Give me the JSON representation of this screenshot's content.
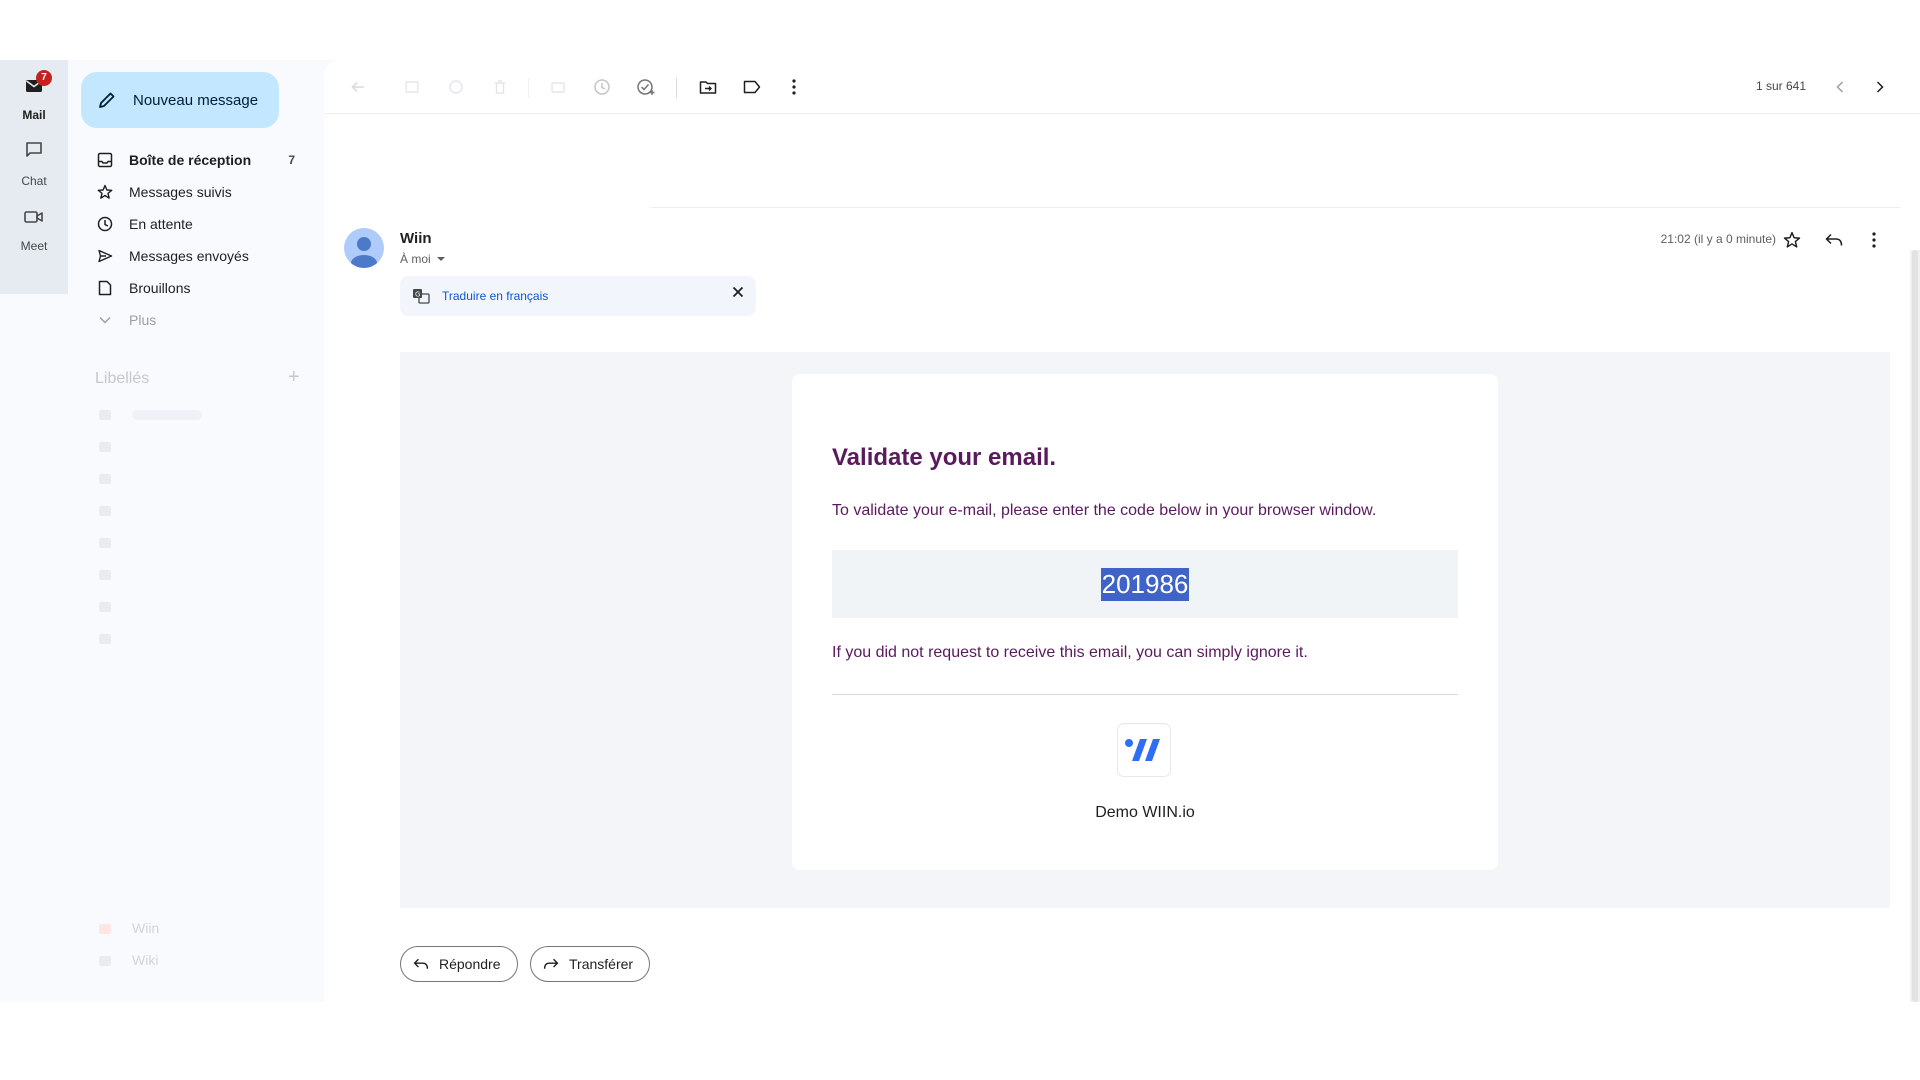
{
  "rail": {
    "mail": {
      "label": "Mail",
      "badge": "7"
    },
    "chat": {
      "label": "Chat"
    },
    "meet": {
      "label": "Meet"
    }
  },
  "sidenav": {
    "compose_label": "Nouveau message",
    "items": [
      {
        "label": "Boîte de réception",
        "count": "7",
        "icon": "inbox-icon"
      },
      {
        "label": "Messages suivis",
        "icon": "star-icon"
      },
      {
        "label": "En attente",
        "icon": "clock-icon"
      },
      {
        "label": "Messages envoyés",
        "icon": "send-icon"
      },
      {
        "label": "Brouillons",
        "icon": "draft-icon"
      },
      {
        "label": "Plus",
        "icon": "chevron-down-icon"
      }
    ],
    "labels_title": "Libellés",
    "bottom_labels": [
      "Wiin",
      "Wiki"
    ]
  },
  "toolbar": {
    "pager": "1 sur 641"
  },
  "message": {
    "sender": "Wiin",
    "to": "À moi",
    "time": "21:02 (il y a 0 minute)",
    "translate_label": "Traduire en français"
  },
  "email": {
    "title": "Validate your email.",
    "instruction": "To validate your e-mail, please enter the code below in your browser window.",
    "code": "201986",
    "note": "If you did not request to receive this email, you can simply ignore it.",
    "brand": "Demo WIIN.io"
  },
  "actions": {
    "reply_label": "Répondre",
    "forward_label": "Transférer"
  },
  "colors": {
    "accent": "#0b57d0",
    "compose_bg": "#c2e7ff",
    "email_text": "#5a1a5e",
    "code_highlight": "#3f63c6",
    "badge": "#c5221f"
  }
}
